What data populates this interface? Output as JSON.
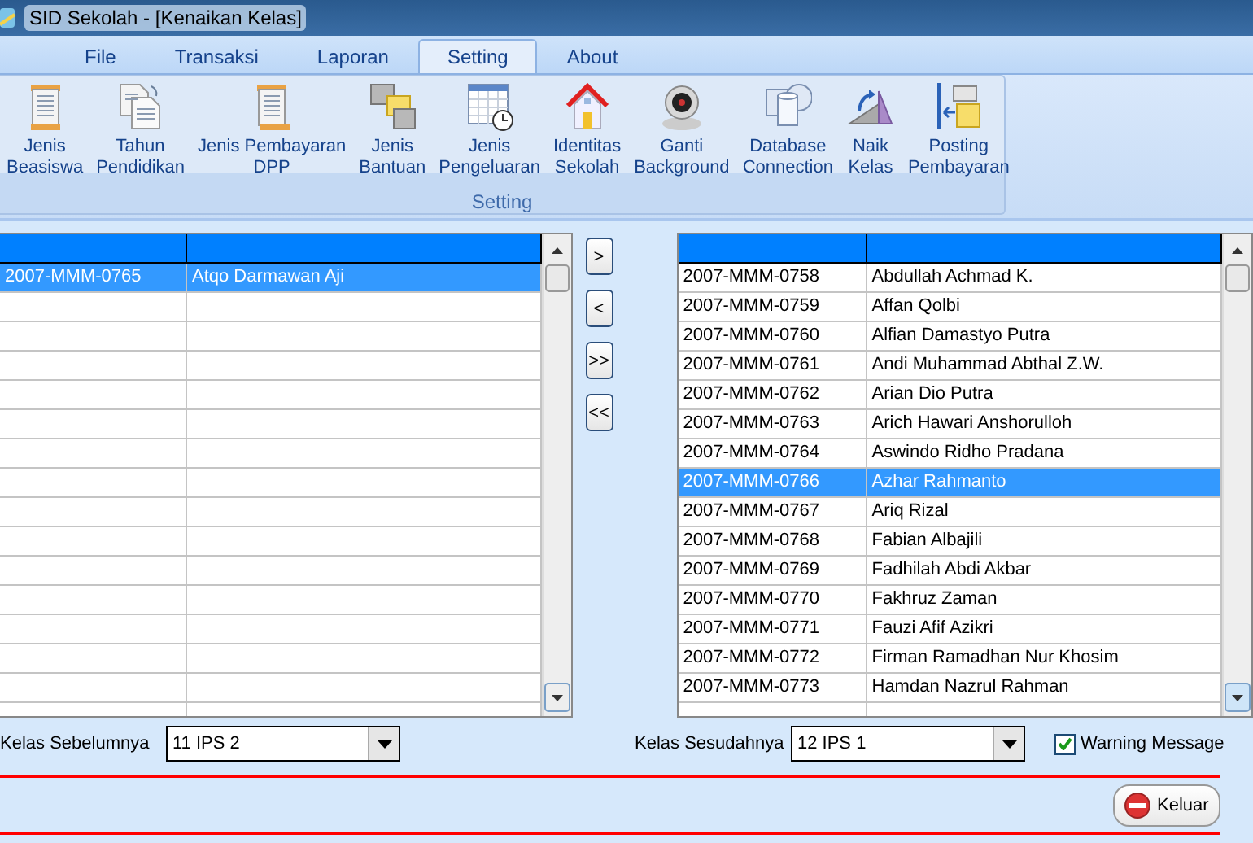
{
  "window": {
    "title": "SID Sekolah - [Kenaikan Kelas]"
  },
  "tabs": [
    {
      "label": "File",
      "selected": false
    },
    {
      "label": "Transaksi",
      "selected": false
    },
    {
      "label": "Laporan",
      "selected": false
    },
    {
      "label": "Setting",
      "selected": true
    },
    {
      "label": "About",
      "selected": false
    }
  ],
  "ribbon": {
    "group_label": "Setting",
    "items": [
      {
        "label": "Jenis\nBeasiswa"
      },
      {
        "label": "Tahun\nPendidikan"
      },
      {
        "label": "Jenis Pembayaran\nDPP"
      },
      {
        "label": "Jenis\nBantuan"
      },
      {
        "label": "Jenis\nPengeluaran"
      },
      {
        "label": "Identitas\nSekolah"
      },
      {
        "label": "Ganti\nBackground"
      },
      {
        "label": "Database\nConnection"
      },
      {
        "label": "Naik\nKelas"
      },
      {
        "label": "Posting\nPembayaran"
      }
    ]
  },
  "left_table": {
    "rows": [
      {
        "id": "2007-MMM-0765",
        "name": "Atqo Darmawan Aji",
        "selected": true
      }
    ]
  },
  "move_buttons": [
    ">",
    "<",
    ">>",
    "<<"
  ],
  "right_table": {
    "rows": [
      {
        "id": "2007-MMM-0758",
        "name": "Abdullah Achmad K.",
        "selected": false
      },
      {
        "id": "2007-MMM-0759",
        "name": "Affan Qolbi",
        "selected": false
      },
      {
        "id": "2007-MMM-0760",
        "name": "Alfian Damastyo Putra",
        "selected": false
      },
      {
        "id": "2007-MMM-0761",
        "name": "Andi Muhammad Abthal Z.W.",
        "selected": false
      },
      {
        "id": "2007-MMM-0762",
        "name": "Arian Dio Putra",
        "selected": false
      },
      {
        "id": "2007-MMM-0763",
        "name": "Arich Hawari Anshorulloh",
        "selected": false
      },
      {
        "id": "2007-MMM-0764",
        "name": "Aswindo Ridho Pradana",
        "selected": false
      },
      {
        "id": "2007-MMM-0766",
        "name": "Azhar Rahmanto",
        "selected": true
      },
      {
        "id": "2007-MMM-0767",
        "name": "Ariq Rizal",
        "selected": false
      },
      {
        "id": "2007-MMM-0768",
        "name": "Fabian Albajili",
        "selected": false
      },
      {
        "id": "2007-MMM-0769",
        "name": "Fadhilah Abdi Akbar",
        "selected": false
      },
      {
        "id": "2007-MMM-0770",
        "name": "Fakhruz Zaman",
        "selected": false
      },
      {
        "id": "2007-MMM-0771",
        "name": "Fauzi Afif Azikri",
        "selected": false
      },
      {
        "id": "2007-MMM-0772",
        "name": "Firman Ramadhan Nur Khosim",
        "selected": false
      },
      {
        "id": "2007-MMM-0773",
        "name": "Hamdan Nazrul Rahman",
        "selected": false
      }
    ]
  },
  "previous_class": {
    "label": "Kelas Sebelumnya",
    "value": "11 IPS 2"
  },
  "next_class": {
    "label": "Kelas Sesudahnya",
    "value": "12 IPS 1"
  },
  "warning_message": {
    "label": "Warning Message",
    "checked": true
  },
  "exit_button": {
    "label": "Keluar"
  }
}
